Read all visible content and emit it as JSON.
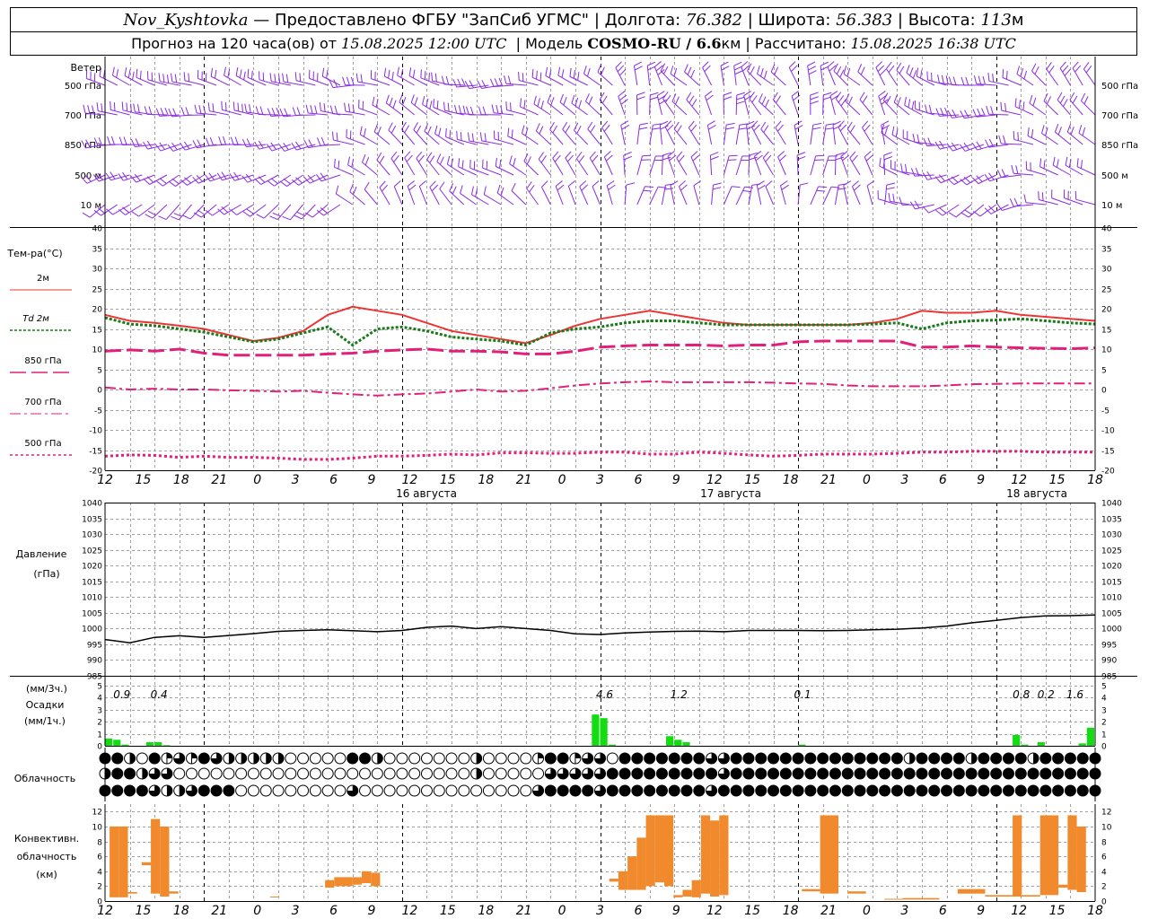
{
  "header": {
    "station": "Nov_Kyshtovka",
    "provider": "— Предоставлено ФГБУ \"ЗапСиб УГМС\"",
    "lon_label": "Долгота:",
    "lon": "76.382",
    "lat_label": "Широта:",
    "lat": "56.383",
    "alt_label": "Высота:",
    "alt": "113",
    "alt_unit": "м",
    "forecast_prefix": "Прогноз на 120 часа(ов) от",
    "forecast_start": "15.08.2025 12:00 UTC",
    "model_label": "Модель",
    "model": "COSMO-RU / 6.6",
    "model_unit": "км",
    "calc_label": "Рассчитано:",
    "calc_time": "15.08.2025 16:38 UTC"
  },
  "colors": {
    "wind": "#8a2be2",
    "t2m": "#ee3333",
    "td": "#1a7a1a",
    "upper": "#e0207a",
    "precip": "#11dd11",
    "convective": "#f08a2c",
    "grid": "#a0a0a0"
  },
  "wind_panel": {
    "title": "Ветер",
    "levels": [
      "500 гПа",
      "700 гПа",
      "850 гПа",
      "500 м",
      "10 м"
    ]
  },
  "temperature_panel": {
    "title": "Тем-ра(°С)",
    "legend": [
      "2м",
      "Td 2м",
      "850 гПа",
      "700 гПа",
      "500 гПа"
    ]
  },
  "pressure_panel": {
    "title": "Давление",
    "unit": "(гПа)"
  },
  "precip_panel": {
    "unit_3h": "(мм/3ч.)",
    "title": "Осадки",
    "unit_1h": "(мм/1ч.)"
  },
  "cloud_panel": {
    "title": "Облачность"
  },
  "convective_panel": {
    "title1": "Конвективн.",
    "title2": "облачность",
    "unit": "(км)"
  },
  "time_axis": {
    "hour_labels": [
      "12",
      "15",
      "18",
      "21",
      "0",
      "3",
      "6",
      "9",
      "12",
      "15",
      "18",
      "21",
      "0",
      "3",
      "6",
      "9",
      "12",
      "15",
      "18",
      "21",
      "0",
      "3",
      "6",
      "9",
      "12",
      "15",
      "18"
    ],
    "date_labels": [
      "16 августа",
      "17 августа",
      "18 августа"
    ]
  },
  "chart_data": [
    {
      "type": "line",
      "title": "Тем-ра(°С)",
      "x_hours": [
        0,
        3,
        6,
        9,
        12,
        15,
        18,
        21,
        24,
        27,
        30,
        33,
        36,
        39,
        42,
        45,
        48,
        51,
        54,
        57,
        60,
        63,
        66,
        69,
        72,
        75,
        78,
        81,
        84,
        87,
        90,
        93,
        96,
        99,
        102,
        105,
        108,
        111,
        114,
        117,
        120
      ],
      "ylim": [
        -20,
        40
      ],
      "yticks": [
        -20,
        -15,
        -10,
        -5,
        0,
        5,
        10,
        15,
        20,
        25,
        30,
        35,
        40
      ],
      "series": [
        {
          "name": "2м",
          "values": [
            18.5,
            17.0,
            16.5,
            15.8,
            15.0,
            13.5,
            12.0,
            12.8,
            14.5,
            18.5,
            20.5,
            19.5,
            18.5,
            16.5,
            14.5,
            13.5,
            12.5,
            11.5,
            13.5,
            15.8,
            17.5,
            18.5,
            19.5,
            18.5,
            17.5,
            16.5,
            16.0,
            16.0,
            16.0,
            16.0,
            16.0,
            16.5,
            17.5,
            19.5,
            19.0,
            19.0,
            19.5,
            18.5,
            18.0,
            17.5,
            17.0
          ]
        },
        {
          "name": "Td 2м",
          "values": [
            17.8,
            16.2,
            15.8,
            15.0,
            14.2,
            13.0,
            11.8,
            12.5,
            14.0,
            15.5,
            11.0,
            15.0,
            15.5,
            14.5,
            13.0,
            12.5,
            12.0,
            11.0,
            14.0,
            15.0,
            15.5,
            16.5,
            17.0,
            17.0,
            16.5,
            16.0,
            16.0,
            16.0,
            16.0,
            16.0,
            16.0,
            16.2,
            16.5,
            15.0,
            16.5,
            17.0,
            17.2,
            17.5,
            17.0,
            16.5,
            16.2
          ]
        },
        {
          "name": "850 гПа",
          "values": [
            9.5,
            9.8,
            9.5,
            10.0,
            9.0,
            8.5,
            8.5,
            8.5,
            8.5,
            8.8,
            9.0,
            9.5,
            9.8,
            10.0,
            9.5,
            9.5,
            9.3,
            8.8,
            8.8,
            9.5,
            10.5,
            10.8,
            11.0,
            11.0,
            11.0,
            10.8,
            11.0,
            11.0,
            11.8,
            12.0,
            12.0,
            12.0,
            12.0,
            10.5,
            10.5,
            10.8,
            10.5,
            10.3,
            10.2,
            10.1,
            10.3
          ]
        },
        {
          "name": "700 гПа",
          "values": [
            0.5,
            0.0,
            0.2,
            0.0,
            0.0,
            -0.2,
            -0.3,
            -0.5,
            -0.3,
            -0.8,
            -1.2,
            -1.5,
            -1.2,
            -1.0,
            -0.5,
            0.0,
            -0.5,
            -0.3,
            0.3,
            1.0,
            1.5,
            1.8,
            2.0,
            1.8,
            1.8,
            1.8,
            1.8,
            1.7,
            1.5,
            1.4,
            1.0,
            0.8,
            0.8,
            0.8,
            1.0,
            1.3,
            1.4,
            1.5,
            1.5,
            1.5,
            1.5
          ]
        },
        {
          "name": "500 гПа",
          "values": [
            -16.5,
            -16.2,
            -16.3,
            -16.8,
            -16.5,
            -16.8,
            -16.8,
            -17.0,
            -17.3,
            -17.3,
            -17.0,
            -16.5,
            -16.5,
            -16.3,
            -16.0,
            -16.2,
            -15.7,
            -15.7,
            -15.8,
            -15.8,
            -15.5,
            -15.5,
            -16.0,
            -16.0,
            -15.5,
            -15.8,
            -16.2,
            -16.5,
            -16.3,
            -16.0,
            -16.0,
            -16.0,
            -15.8,
            -15.5,
            -15.5,
            -15.3,
            -15.3,
            -15.3,
            -15.5,
            -15.5,
            -15.5
          ]
        }
      ]
    },
    {
      "type": "line",
      "title": "Давление",
      "ylabel": "(гПа)",
      "ylim": [
        985,
        1040
      ],
      "yticks": [
        985,
        990,
        995,
        1000,
        1005,
        1010,
        1015,
        1020,
        1025,
        1030,
        1035,
        1040
      ],
      "x_hours": [
        0,
        3,
        6,
        9,
        12,
        15,
        18,
        21,
        24,
        27,
        30,
        33,
        36,
        39,
        42,
        45,
        48,
        51,
        54,
        57,
        60,
        63,
        66,
        69,
        72,
        75,
        78,
        81,
        84,
        87,
        90,
        93,
        96,
        99,
        102,
        105,
        108,
        111,
        114,
        117,
        120
      ],
      "series": [
        {
          "name": "Давление",
          "values": [
            996.5,
            995.5,
            997.2,
            997.7,
            997.2,
            997.8,
            998.4,
            999.1,
            999.4,
            999.6,
            999.3,
            999.0,
            999.4,
            1000.4,
            1000.8,
            1000.0,
            1000.6,
            1000.0,
            999.4,
            998.3,
            998.1,
            998.6,
            998.9,
            999.1,
            999.2,
            999.0,
            999.4,
            999.4,
            999.4,
            999.3,
            999.4,
            999.6,
            999.8,
            1000.2,
            1000.8,
            1001.8,
            1002.6,
            1003.5,
            1004.0,
            1004.1,
            1004.3
          ]
        }
      ]
    },
    {
      "type": "bar",
      "title": "Осадки",
      "ylabel": "(мм/1ч.)",
      "ylim": [
        0,
        5
      ],
      "yticks": [
        0,
        1,
        2,
        3,
        4,
        5
      ],
      "x_hours": [
        0,
        1,
        2,
        5,
        6,
        7,
        59,
        60,
        61,
        68,
        69,
        70,
        84,
        110,
        111,
        113,
        118,
        119
      ],
      "values": [
        0.6,
        0.5,
        0.1,
        0.3,
        0.3,
        0.05,
        2.6,
        2.3,
        0.1,
        0.8,
        0.5,
        0.3,
        0.1,
        0.9,
        0.1,
        0.3,
        0.2,
        1.5
      ],
      "labels_3h": [
        {
          "x_hours": 1.5,
          "text": "0.9"
        },
        {
          "x_hours": 6,
          "text": "0.4"
        },
        {
          "x_hours": 60,
          "text": "4.6"
        },
        {
          "x_hours": 69,
          "text": "1.2"
        },
        {
          "x_hours": 84,
          "text": "0.1"
        },
        {
          "x_hours": 110.5,
          "text": "0.8"
        },
        {
          "x_hours": 113.5,
          "text": "0.2"
        },
        {
          "x_hours": 117,
          "text": "1.6"
        }
      ]
    },
    {
      "type": "bar",
      "title": "Конвективн. облачность",
      "ylabel": "(км)",
      "ylim": [
        0,
        13
      ],
      "yticks": [
        0,
        2,
        4,
        6,
        8,
        10,
        12
      ],
      "series": [
        {
          "name": "",
          "bars": [
            [
              0.5,
              1.5,
              0.5,
              10
            ],
            [
              1.5,
              2.5,
              0.5,
              10
            ],
            [
              2.5,
              3.5,
              1.0,
              1.2
            ],
            [
              4,
              5,
              4.8,
              5.2
            ],
            [
              5,
              6,
              1.0,
              11
            ],
            [
              6,
              7,
              0.6,
              10
            ],
            [
              7,
              8,
              1.0,
              1.3
            ],
            [
              18,
              19,
              0.5,
              0.6
            ],
            [
              24,
              25,
              1.8,
              2.8
            ],
            [
              25,
              27,
              2.0,
              3.2
            ],
            [
              27,
              28,
              2.2,
              3.2
            ],
            [
              28,
              29,
              2.4,
              4.0
            ],
            [
              29,
              30,
              2.0,
              3.8
            ],
            [
              55,
              56,
              2.6,
              3.0
            ],
            [
              56,
              57,
              1.5,
              4.0
            ],
            [
              57,
              58,
              1.5,
              6.0
            ],
            [
              58,
              59,
              1.5,
              8.5
            ],
            [
              59,
              60,
              2.0,
              11.5
            ],
            [
              60,
              61,
              2.5,
              11.5
            ],
            [
              61,
              62,
              2.0,
              11.5
            ],
            [
              62,
              63,
              0.5,
              0.8
            ],
            [
              63,
              64,
              0.6,
              1.5
            ],
            [
              64,
              65,
              0.5,
              2.8
            ],
            [
              65,
              66,
              1.0,
              11.5
            ],
            [
              66,
              67,
              0.6,
              10.8
            ],
            [
              67,
              68,
              0.8,
              11.5
            ],
            [
              76,
              78,
              1.3,
              1.6
            ],
            [
              78,
              80,
              1.0,
              11.5
            ],
            [
              81,
              83,
              1.0,
              1.3
            ],
            [
              85,
              87,
              0.2,
              0.3
            ],
            [
              87,
              91,
              0.2,
              0.4
            ],
            [
              93,
              96,
              1.0,
              1.6
            ],
            [
              96,
              99,
              0.6,
              0.8
            ],
            [
              99,
              100,
              0.6,
              11.5
            ],
            [
              100,
              101,
              0.6,
              0.8
            ],
            [
              101,
              102,
              0.6,
              0.8
            ],
            [
              102,
              104,
              0.8,
              11.5
            ],
            [
              104,
              105,
              1.8,
              2.2
            ],
            [
              105,
              106,
              1.5,
              11.5
            ],
            [
              106,
              107,
              1.2,
              10.0
            ]
          ]
        }
      ]
    },
    {
      "type": "table",
      "title": "Облачность",
      "note": "Символы облачности по 3 ярусам: 0-8 октантов",
      "x_count": 81,
      "rows": [
        [
          8,
          8,
          4,
          0,
          8,
          3,
          5,
          3,
          8,
          5,
          4,
          4,
          4,
          4,
          4,
          0,
          0,
          0,
          0,
          0,
          8,
          8,
          4,
          0,
          0,
          0,
          0,
          0,
          0,
          0,
          4,
          0,
          0,
          0,
          0,
          3,
          8,
          8,
          3,
          5,
          5,
          0,
          8,
          8,
          8,
          8,
          8,
          8,
          8,
          5,
          5,
          8,
          8,
          8,
          8,
          8,
          8,
          8,
          8,
          8,
          8,
          8,
          8,
          8,
          8,
          4,
          8,
          8,
          8,
          8,
          4,
          8,
          8,
          8,
          8,
          4,
          8,
          8,
          8,
          8,
          8
        ],
        [
          4,
          8,
          8,
          4,
          5,
          6,
          0,
          0,
          0,
          0,
          0,
          0,
          0,
          0,
          0,
          0,
          0,
          0,
          0,
          0,
          0,
          0,
          0,
          0,
          0,
          0,
          0,
          0,
          0,
          0,
          4,
          0,
          0,
          0,
          0,
          0,
          5,
          5,
          5,
          5,
          5,
          8,
          8,
          8,
          8,
          8,
          8,
          8,
          8,
          8,
          5,
          8,
          8,
          8,
          8,
          8,
          8,
          8,
          8,
          8,
          8,
          8,
          8,
          8,
          8,
          8,
          8,
          8,
          8,
          8,
          8,
          8,
          8,
          8,
          8,
          8,
          8,
          8,
          8,
          8,
          8
        ],
        [
          8,
          8,
          8,
          8,
          5,
          4,
          4,
          5,
          8,
          8,
          8,
          0,
          0,
          0,
          0,
          0,
          0,
          0,
          0,
          0,
          5,
          0,
          0,
          0,
          0,
          0,
          0,
          0,
          0,
          0,
          0,
          0,
          0,
          0,
          0,
          5,
          8,
          8,
          8,
          8,
          5,
          8,
          8,
          8,
          8,
          8,
          8,
          8,
          8,
          5,
          8,
          8,
          8,
          8,
          8,
          8,
          8,
          8,
          8,
          8,
          8,
          8,
          8,
          8,
          8,
          8,
          8,
          8,
          8,
          8,
          8,
          8,
          8,
          8,
          8,
          8,
          8,
          8,
          8,
          8,
          8
        ]
      ]
    }
  ]
}
